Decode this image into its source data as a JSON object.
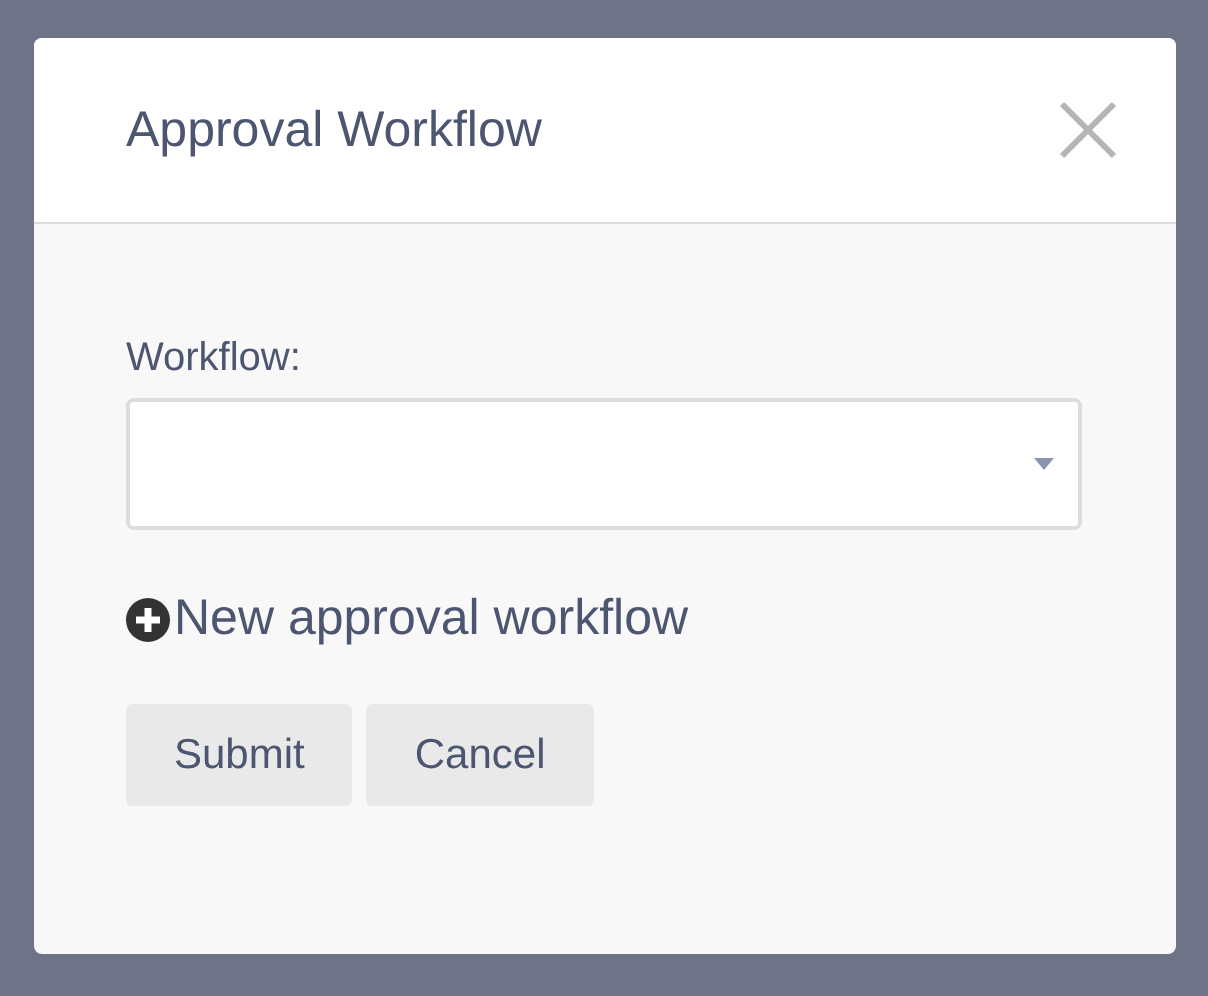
{
  "dialog": {
    "title": "Approval Workflow"
  },
  "form": {
    "label": "Workflow:",
    "link": "New approval workflow"
  },
  "buttons": [
    {
      "label": "Submit"
    },
    {
      "label": "Cancel"
    }
  ]
}
